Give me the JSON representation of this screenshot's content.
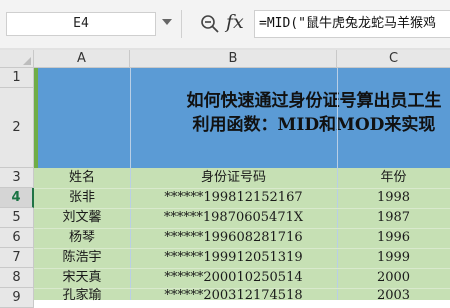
{
  "formula_bar": {
    "name_box": "E4",
    "fx_label": "fx",
    "formula": "=MID(\"鼠牛虎兔龙蛇马羊猴鸡"
  },
  "sheet": {
    "column_headers": [
      "A",
      "B",
      "C"
    ],
    "row_headers": [
      "1",
      "2",
      "3",
      "4",
      "5",
      "6",
      "7",
      "8",
      "9"
    ],
    "title_line1": "如何快速通过身份证号算出员工生",
    "title_line2": "利用函数：MID和MOD来实现",
    "header": {
      "name": "姓名",
      "id": "身份证号码",
      "year": "年份"
    },
    "rows": [
      {
        "name": "张非",
        "id": "******199812152167",
        "year": "1998"
      },
      {
        "name": "刘文馨",
        "id": "******19870605471X",
        "year": "1987"
      },
      {
        "name": "杨琴",
        "id": "******199608281716",
        "year": "1996"
      },
      {
        "name": "陈浩宇",
        "id": "******199912051319",
        "year": "1999"
      },
      {
        "name": "宋天真",
        "id": "******200010250514",
        "year": "2000"
      },
      {
        "name": "孔家瑜",
        "id": "******200312174518",
        "year": "2003"
      }
    ]
  },
  "colors": {
    "title_fill": "#5b9bd5",
    "data_fill": "#c6e0b4",
    "accent": "#217346"
  }
}
